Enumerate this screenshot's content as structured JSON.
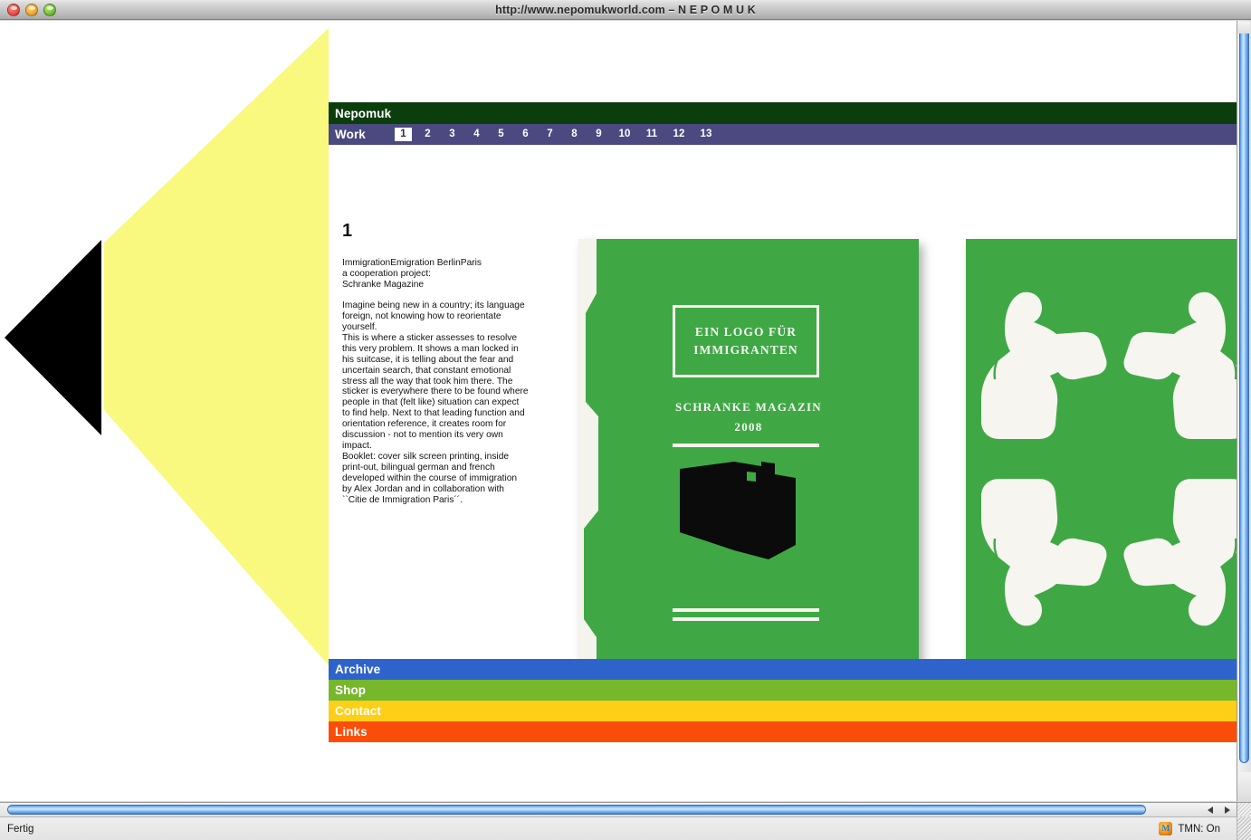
{
  "window": {
    "title": "http://www.nepomukworld.com – N E P O M U K",
    "traffic_lights": [
      "close",
      "minimize",
      "zoom"
    ]
  },
  "colors": {
    "nepomuk_bar": "#0c3d0c",
    "work_bar": "#4a4a80",
    "archive_bar": "#2f63cc",
    "shop_bar": "#77b72b",
    "contact_bar": "#fdcf16",
    "links_bar": "#fb4d0a",
    "wedge_yellow": "#f9f97f",
    "wedge_black": "#000000",
    "book_green": "#3fa845"
  },
  "site": {
    "brand": "Nepomuk",
    "work": {
      "label": "Work",
      "active": "1",
      "numbers": [
        "1",
        "2",
        "3",
        "4",
        "5",
        "6",
        "7",
        "8",
        "9",
        "10",
        "11",
        "12",
        "13"
      ]
    },
    "nav": {
      "archive": "Archive",
      "shop": "Shop",
      "contact": "Contact",
      "links": "Links"
    },
    "project": {
      "number": "1",
      "heading_line1": "ImmigrationEmigration BerlinParis",
      "heading_line2": "a cooperation project:",
      "heading_line3": "Schranke Magazine",
      "body_para1": "Imagine being new in a country; its language foreign, not knowing how to reorientate yourself.",
      "body_para2": "This is where a sticker assesses to resolve this very problem. It shows a man locked in his suitcase, it is telling about the fear and uncertain search, that constant emotional stress all the way that took him there. The sticker is everywhere there to be found where people in that (felt like) situation can expect to find help. Next to that leading function and orientation reference, it creates room for discussion - not to mention its very own impact.",
      "body_para3": "Booklet: cover silk screen printing, inside print-out, bilingual german and french developed within the course of immigration by Alex Jordan and in collaboration with ``Citie de Immigration Paris´´."
    },
    "book_cover": {
      "title_line1": "EIN LOGO FÜR",
      "title_line2": "IMMIGRANTEN",
      "magazine": "SCHRANKE MAGAZIN",
      "year": "2008"
    }
  },
  "statusbar": {
    "message": "Fertig",
    "tmn": "TMN: On",
    "tmn_icon_glyph": "M"
  }
}
